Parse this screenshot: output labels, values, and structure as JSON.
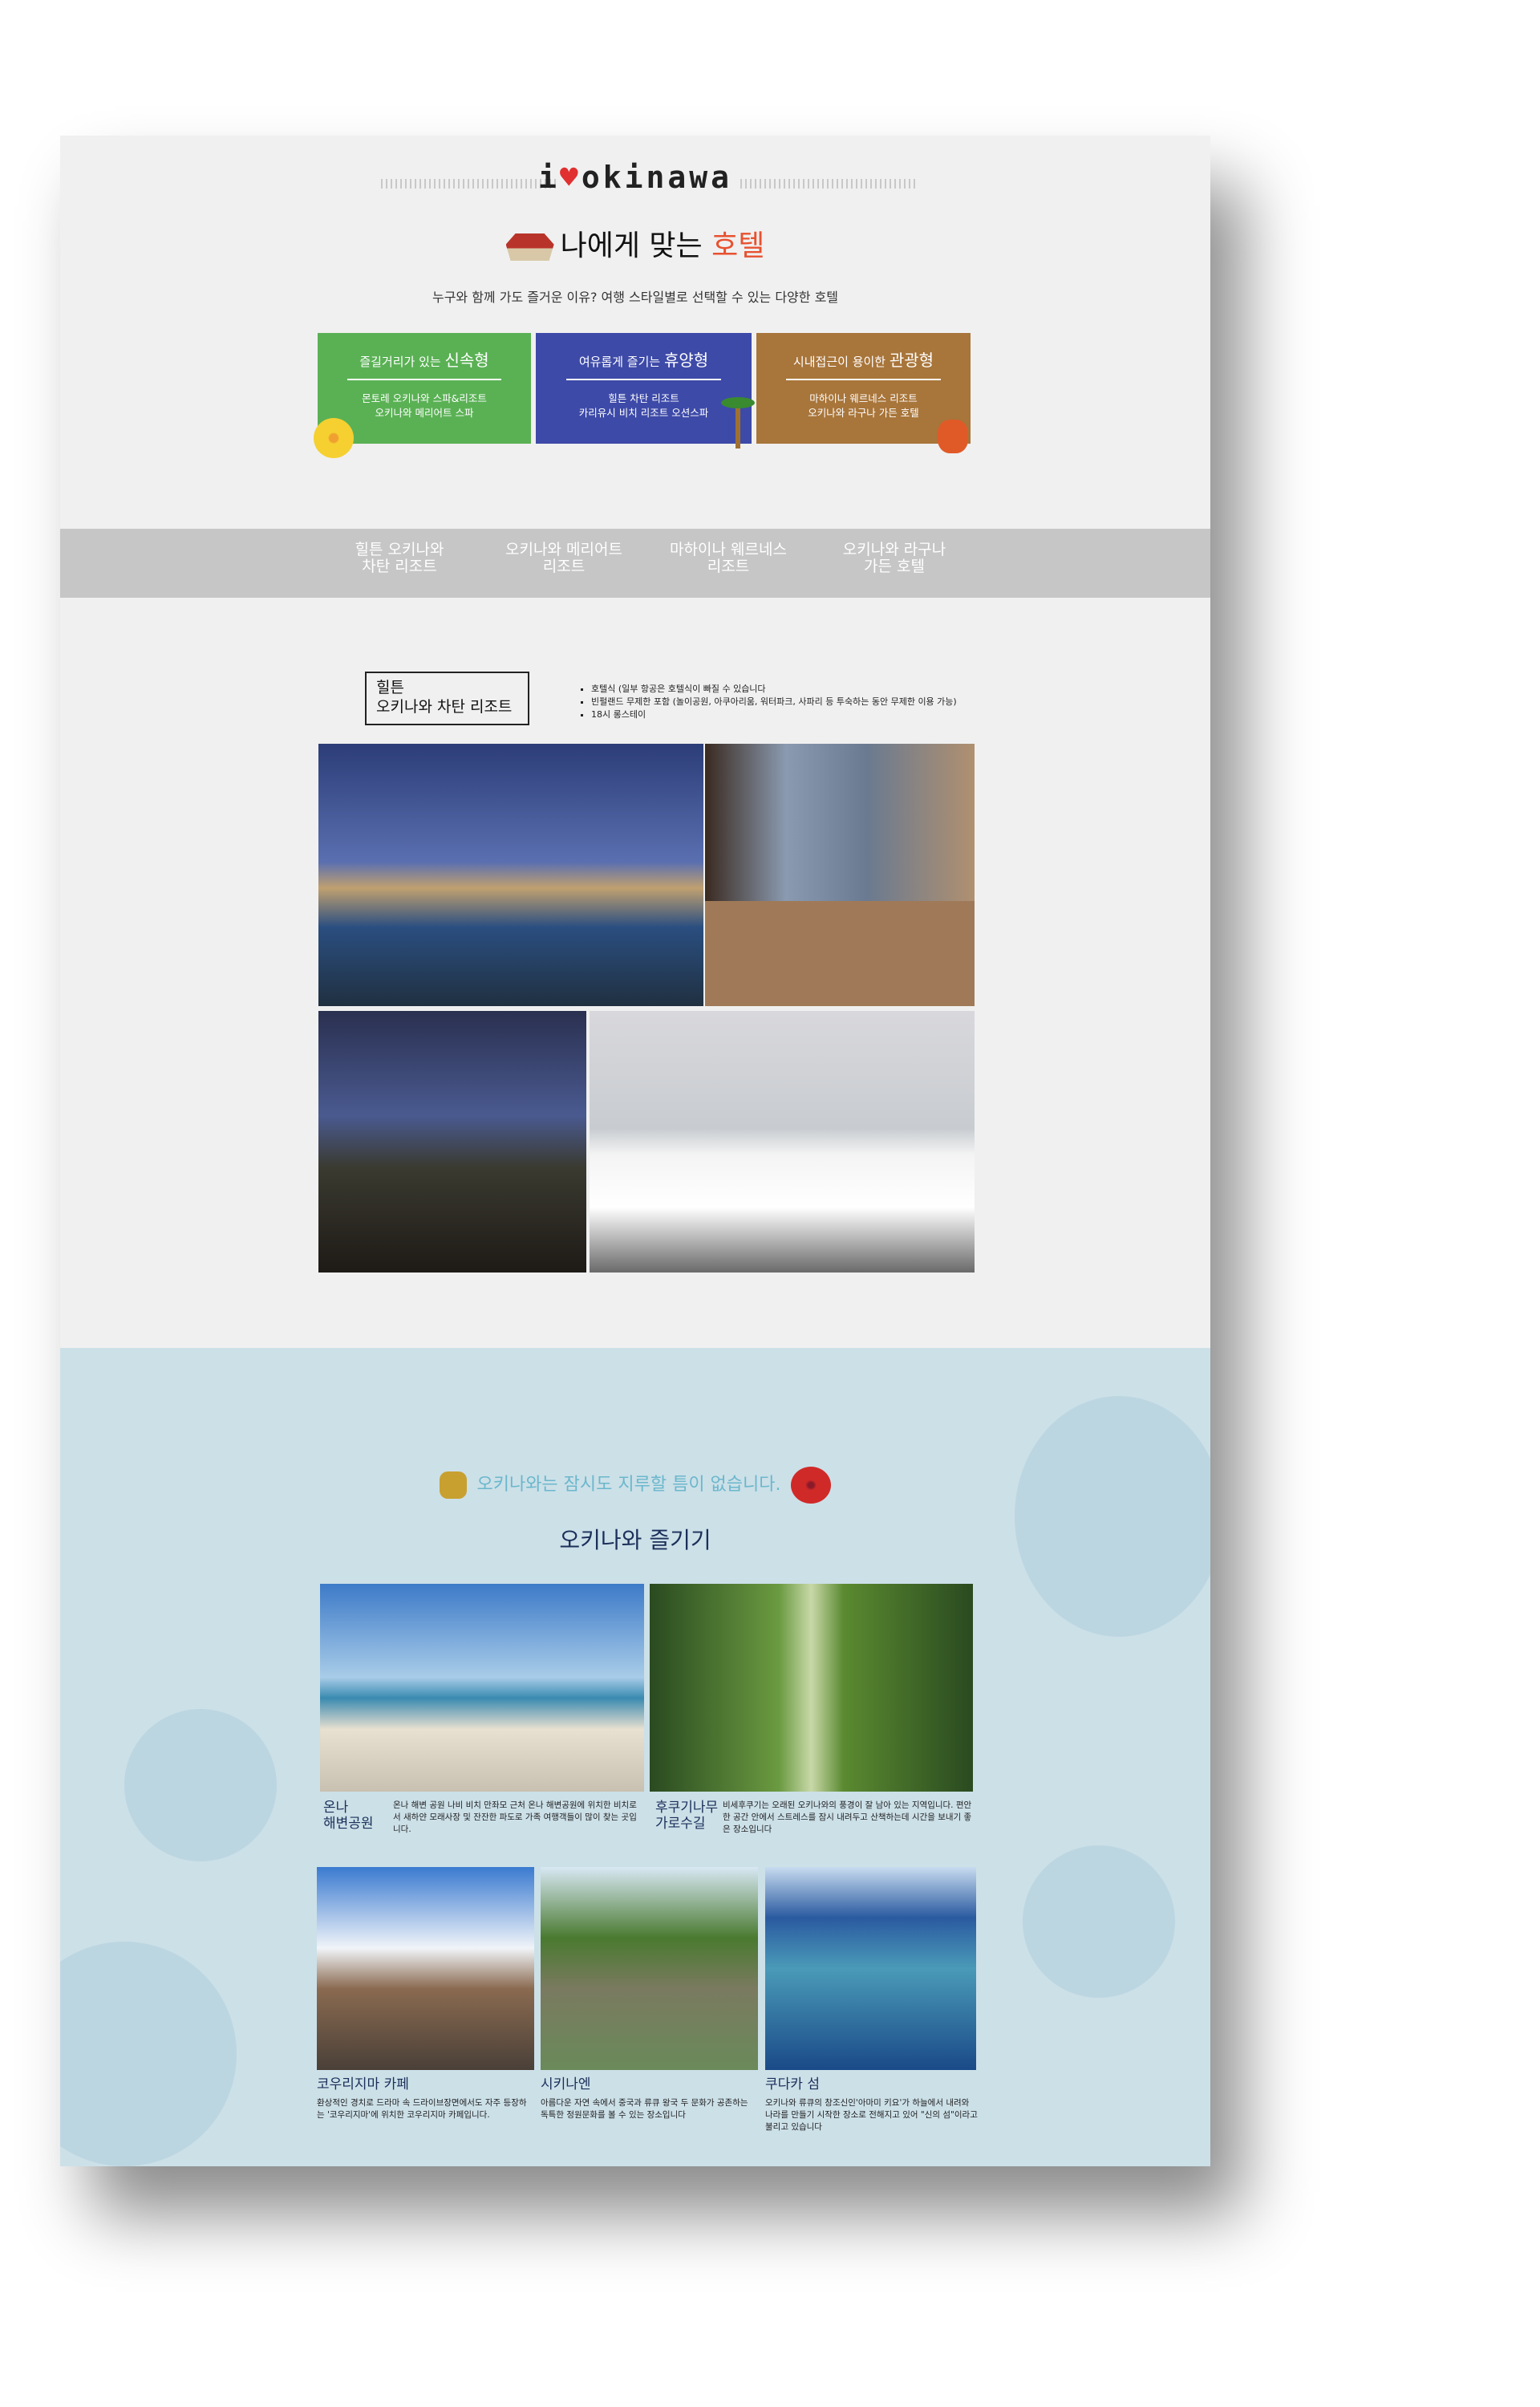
{
  "header": {
    "logo_i": "i",
    "logo_rest": "okinawa",
    "title_main": "나에게 맞는 ",
    "title_accent": "호텔",
    "subtitle": "누구와 함께 가도 즐거운 이유? 여행 스타일별로 선택할 수 있는 다양한 호텔"
  },
  "cards": [
    {
      "prefix": "즐길거리가 있는 ",
      "type": "신속형",
      "hotels": [
        "몬토레 오키나와 스파&리조트",
        "오키나와 메리어트 스파"
      ],
      "color": "#5ab154"
    },
    {
      "prefix": "여유롭게 즐기는 ",
      "type": "휴양형",
      "hotels": [
        "힐튼 차탄 리조트",
        "카리유시 비치 리조트 오션스파"
      ],
      "color": "#3d4aa8"
    },
    {
      "prefix": "시내접근이 용이한 ",
      "type": "관광형",
      "hotels": [
        "마하이나 웨르네스 리조트",
        "오키나와 라구나 가든 호텔"
      ],
      "color": "#a8753a"
    }
  ],
  "nav": {
    "items": [
      [
        "힐튼 오키나와",
        "차탄 리조트"
      ],
      [
        "오키나와 메리어트",
        "리조트"
      ],
      [
        "마하이나 웨르네스",
        "리조트"
      ],
      [
        "오키나와 라구나",
        "가든 호텔"
      ]
    ]
  },
  "hotel": {
    "name_line1": "힐튼",
    "name_line2": "오키나와 차탄 리조트",
    "features": [
      "호텔식 (일부 항공은 호텔식이 빠질 수 있습니다",
      "빈펄랜드 무제한 포함 (놀이공원, 아쿠아리움, 워터파크, 사파리 등 투숙하는 동안 무제한 이용 가능)",
      "18시 롱스테이"
    ]
  },
  "enjoy": {
    "tagline": "오키나와는 잠시도 지루할 틈이 없습니다.",
    "title": "오키나와 즐기기",
    "spots_large": [
      {
        "name": [
          "온나",
          "해변공원"
        ],
        "desc": "온나 해변 공원 나비 비치 만좌모 근처 온나 해변공원에 위치한 비치로서 새하얀 모래사장 및 잔잔한 파도로 가족 여행객들이 많이 찾는 곳입니다."
      },
      {
        "name": [
          "후쿠기나무",
          "가로수길"
        ],
        "desc": "비세후쿠기는 오래된 오키나와의 풍경이 잘 남아 있는 지역입니다. 편안한 공간 안에서 스트레스를 잠시 내려두고 산책하는데 시간을 보내기 좋은 장소입니다"
      }
    ],
    "spots_small": [
      {
        "name": "코우리지마 카페",
        "desc": "환상적인 경치로 드라마 속 드라이브장면에서도 자주 등장하는 '코우리지마'에 위치한 코우리지마 카페입니다."
      },
      {
        "name": "시키나엔",
        "desc": "아름다운 자연 속에서 중국과 류큐 왕국 두 문화가 공존하는 독특한 정원문화를 볼 수 있는 장소입니다"
      },
      {
        "name": "쿠다카 섬",
        "desc": "오키나와 류큐의 창조신인'아마미 키요'가 하늘에서 내려와 나라를 만들기 시작한 장소로 전해지고 있어 \"신의 섬\"이라고 불리고 있습니다"
      }
    ]
  }
}
